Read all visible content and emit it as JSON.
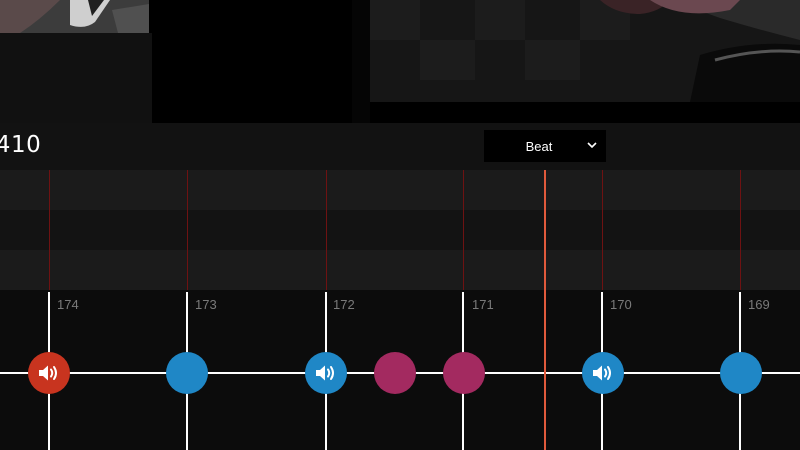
{
  "header": {
    "time_readout": ".410"
  },
  "snap_dropdown": {
    "selected": "Beat",
    "icon": "chevron-down-icon"
  },
  "timeline": {
    "beat_labels": [
      "174",
      "173",
      "172",
      "171",
      "170",
      "169"
    ]
  },
  "notes": [
    {
      "kind": "sound",
      "color": "#c8341f",
      "icon": "speaker-icon"
    },
    {
      "kind": "plain",
      "color": "#1f87c6"
    },
    {
      "kind": "sound",
      "color": "#1f87c6",
      "icon": "speaker-icon"
    },
    {
      "kind": "plain",
      "color": "#a32a60"
    },
    {
      "kind": "plain",
      "color": "#a32a60"
    },
    {
      "kind": "sound",
      "color": "#1f87c6",
      "icon": "speaker-icon"
    },
    {
      "kind": "plain",
      "color": "#1f87c6"
    }
  ],
  "colors": {
    "playhead": "#e05a3c",
    "lane_line": "#6e1212",
    "red_note": "#c8341f",
    "blue_note": "#1f87c6",
    "magenta_note": "#a32a60"
  }
}
